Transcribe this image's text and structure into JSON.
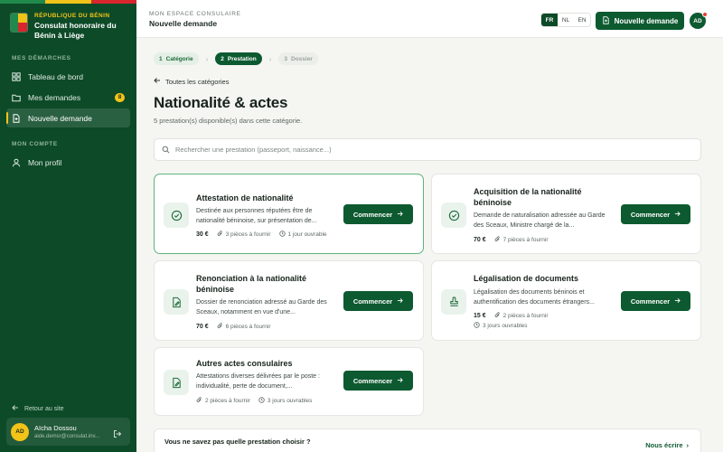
{
  "sidebar": {
    "brand_kicker": "République du Bénin",
    "brand_name": "Consulat honoraire du Bénin à Liège",
    "section_demarches": "Mes démarches",
    "items": [
      {
        "label": "Tableau de bord",
        "icon": "dashboard-icon"
      },
      {
        "label": "Mes demandes",
        "icon": "folder-icon",
        "badge": "8"
      },
      {
        "label": "Nouvelle demande",
        "icon": "file-plus-icon",
        "active": true
      }
    ],
    "section_compte": "Mon compte",
    "profile_label": "Mon profil",
    "back_label": "Retour au site",
    "user": {
      "initials": "AD",
      "name": "Aïcha Dossou",
      "email": "aide.demsr@consulat.inv..."
    }
  },
  "topbar": {
    "kicker": "Mon espace consulaire",
    "title": "Nouvelle demande",
    "languages": [
      "FR",
      "NL",
      "EN"
    ],
    "active_language": "FR",
    "new_request_label": "Nouvelle demande",
    "avatar_initials": "AD"
  },
  "steps": [
    {
      "num": "1",
      "label": "Catégorie",
      "state": "done"
    },
    {
      "num": "2",
      "label": "Prestation",
      "state": "current"
    },
    {
      "num": "3",
      "label": "Dossier",
      "state": "todo"
    }
  ],
  "back_link": "Toutes les catégories",
  "page_title": "Nationalité & actes",
  "subtitle": "5 prestation(s) disponible(s) dans cette catégorie.",
  "search": {
    "placeholder": "Rechercher une prestation (passeport, naissance...)",
    "value": ""
  },
  "cards": [
    {
      "title": "Attestation de nationalité",
      "description": "Destinée aux personnes réputées être de nationalité béninoise, sur présentation de...",
      "price": "30 €",
      "pieces": "3 pièces à fournir",
      "delay": "1 jour ouvrable",
      "button": "Commencer",
      "icon": "check-circle-icon"
    },
    {
      "title": "Acquisition de la nationalité béninoise",
      "description": "Demande de naturalisation adressée au Garde des Sceaux, Ministre chargé de la...",
      "price": "70 €",
      "pieces": "7 pièces à fournir",
      "delay": "",
      "button": "Commencer",
      "icon": "check-circle-icon"
    },
    {
      "title": "Renonciation à la nationalité béninoise",
      "description": "Dossier de renonciation adressé au Garde des Sceaux, notamment en vue d'une...",
      "price": "70 €",
      "pieces": "6 pièces à fournir",
      "delay": "",
      "button": "Commencer",
      "icon": "edit-document-icon"
    },
    {
      "title": "Légalisation de documents",
      "description": "Légalisation des documents béninois et authentification des documents étrangers...",
      "price": "15 €",
      "pieces": "2 pièces à fournir",
      "delay": "3 jours ouvrables",
      "button": "Commencer",
      "icon": "stamp-icon"
    },
    {
      "title": "Autres actes consulaires",
      "description": "Attestations diverses délivrées par le poste : individualité, perte de document,...",
      "price": "",
      "pieces": "2 pièces à fournir",
      "delay": "3 jours ouvrables",
      "button": "Commencer",
      "icon": "edit-document-icon"
    }
  ],
  "help": {
    "question": "Vous ne savez pas quelle prestation choisir ?",
    "link": "Nous écrire"
  },
  "colors": {
    "primary": "#0d5a30",
    "sidebar": "#0d4a28",
    "accent_yellow": "#f2c318",
    "accent_red": "#d8262c",
    "selected_border": "#5fb27a"
  }
}
